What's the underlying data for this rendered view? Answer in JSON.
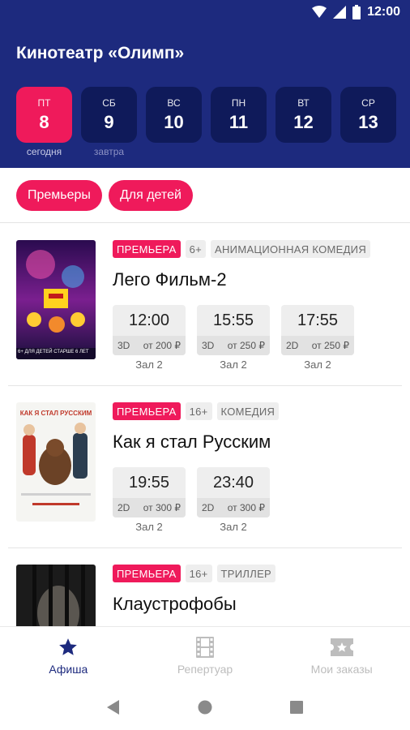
{
  "status_bar": {
    "time": "12:00"
  },
  "header": {
    "title": "Кинотеатр «Олимп»"
  },
  "dates": [
    {
      "day": "ПТ",
      "num": "8",
      "caption": "сегодня",
      "active": true
    },
    {
      "day": "СБ",
      "num": "9",
      "caption": "завтра",
      "active": false
    },
    {
      "day": "ВС",
      "num": "10",
      "caption": "",
      "active": false
    },
    {
      "day": "ПН",
      "num": "11",
      "caption": "",
      "active": false
    },
    {
      "day": "ВТ",
      "num": "12",
      "caption": "",
      "active": false
    },
    {
      "day": "СР",
      "num": "13",
      "caption": "",
      "active": false
    }
  ],
  "filters": [
    "Премьеры",
    "Для детей"
  ],
  "movies": [
    {
      "title": "Лего Фильм-2",
      "tags": {
        "premiere": "ПРЕМЬЕРА",
        "age": "6+",
        "genre": "АНИМАЦИОННАЯ КОМЕДИЯ"
      },
      "poster_caption": "6+ ДЛЯ ДЕТЕЙ СТАРШЕ 6 ЛЕТ",
      "sessions": [
        {
          "time": "12:00",
          "format": "3D",
          "price": "от 200 ₽",
          "hall": "Зал 2"
        },
        {
          "time": "15:55",
          "format": "3D",
          "price": "от 250 ₽",
          "hall": "Зал 2"
        },
        {
          "time": "17:55",
          "format": "2D",
          "price": "от 250 ₽",
          "hall": "Зал 2"
        }
      ]
    },
    {
      "title": "Как я стал Русским",
      "tags": {
        "premiere": "ПРЕМЬЕРА",
        "age": "16+",
        "genre": "КОМЕДИЯ"
      },
      "poster_caption": "КАК Я СТАЛ РУССКИМ",
      "sessions": [
        {
          "time": "19:55",
          "format": "2D",
          "price": "от 300 ₽",
          "hall": "Зал 2"
        },
        {
          "time": "23:40",
          "format": "2D",
          "price": "от 300 ₽",
          "hall": "Зал 2"
        }
      ]
    },
    {
      "title": "Клаустрофобы",
      "tags": {
        "premiere": "ПРЕМЬЕРА",
        "age": "16+",
        "genre": "ТРИЛЛЕР"
      },
      "sessions": []
    }
  ],
  "bottom_nav": [
    {
      "label": "Афиша",
      "icon": "star-icon",
      "active": true
    },
    {
      "label": "Репертуар",
      "icon": "film-icon",
      "active": false
    },
    {
      "label": "Мои заказы",
      "icon": "ticket-icon",
      "active": false
    }
  ],
  "colors": {
    "primary": "#1d2a7e",
    "accent": "#ef1a5b",
    "card": "#0f1a5a"
  }
}
